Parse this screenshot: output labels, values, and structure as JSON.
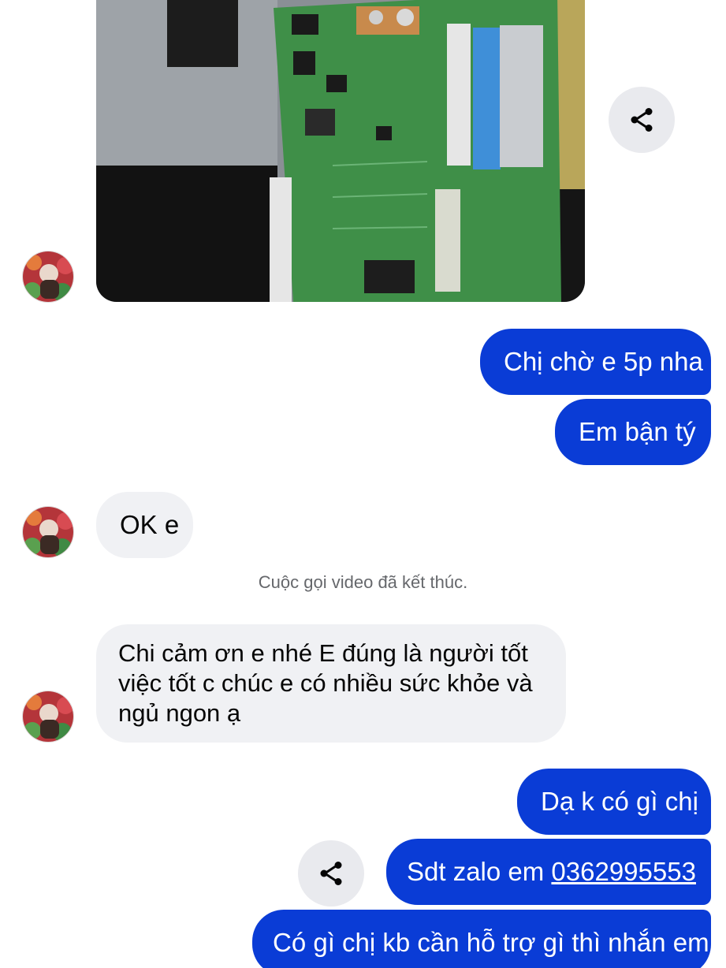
{
  "messages": {
    "out_wait": "Chị chờ e 5p nha",
    "out_busy": "Em bận tý",
    "in_ok": "OK e",
    "call_status": "Cuộc gọi video đã kết thúc.",
    "in_thanks_line1": "Chi cảm ơn e nhé E đúng là người tốt",
    "in_thanks_line2": "việc tốt c chúc e có nhiều sức khỏe và",
    "in_thanks_line3": "ngủ ngon ạ",
    "out_welcome": "Dạ k có gì chị",
    "out_zalo_prefix": "Sdt zalo em ",
    "out_zalo_phone": "0362995553",
    "out_support": "Có gì chị kb cần hỗ trợ gì thì nhắn em"
  },
  "icons": {
    "share": "share-icon",
    "avatar": "contact-avatar"
  },
  "colors": {
    "outgoing_bubble": "#0a3cd6",
    "incoming_bubble": "#f0f1f4",
    "share_button": "#e9eaee",
    "system_text": "#65676b"
  }
}
